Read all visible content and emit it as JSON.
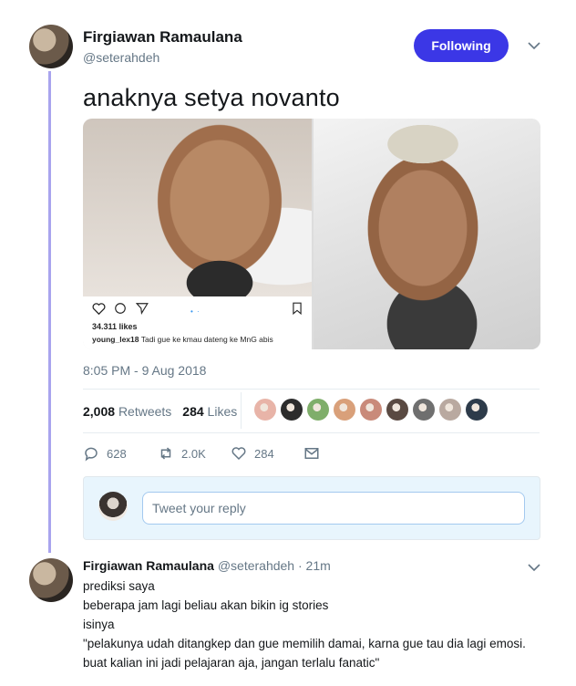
{
  "tweet": {
    "author_name": "Firgiawan Ramaulana",
    "author_handle": "@seterahdeh",
    "follow_label": "Following",
    "text": "anaknya setya novanto",
    "timestamp": "8:05 PM - 9 Aug 2018",
    "media": {
      "left_image": "instagram-post-screenshot",
      "ig_likes": "34.311 likes",
      "ig_caption_user": "young_lex18",
      "ig_caption_text": "Tadi gue ke kmau dateng ke MnG  abis",
      "right_image": "photo-face-closeup"
    },
    "retweets_count": "2,008",
    "retweets_label": "Retweets",
    "likes_count": "284",
    "likes_label": "Likes",
    "liker_colors": [
      "#e8b4a8",
      "#2c2c2c",
      "#7fae6a",
      "#d9a07a",
      "#c98a7a",
      "#5a4a42",
      "#6f6f6f",
      "#b9a9a0",
      "#2d3b4a"
    ],
    "actions": {
      "reply_count": "628",
      "retweet_count": "2.0K",
      "like_count": "284"
    },
    "reply_placeholder": "Tweet your reply"
  },
  "reply": {
    "author_name": "Firgiawan Ramaulana",
    "author_handle": "@seterahdeh",
    "time": "· 21m",
    "lines": [
      "prediksi saya",
      "beberapa jam lagi beliau akan bikin ig stories",
      "isinya",
      "\"pelakunya udah ditangkep dan gue memilih damai, karna gue tau dia lagi emosi.",
      "buat kalian ini jadi pelajaran aja, jangan terlalu fanatic\""
    ]
  },
  "colors": {
    "accent": "#3b37e6",
    "thread_line": "#a9a4ee",
    "muted_text": "#657786"
  }
}
